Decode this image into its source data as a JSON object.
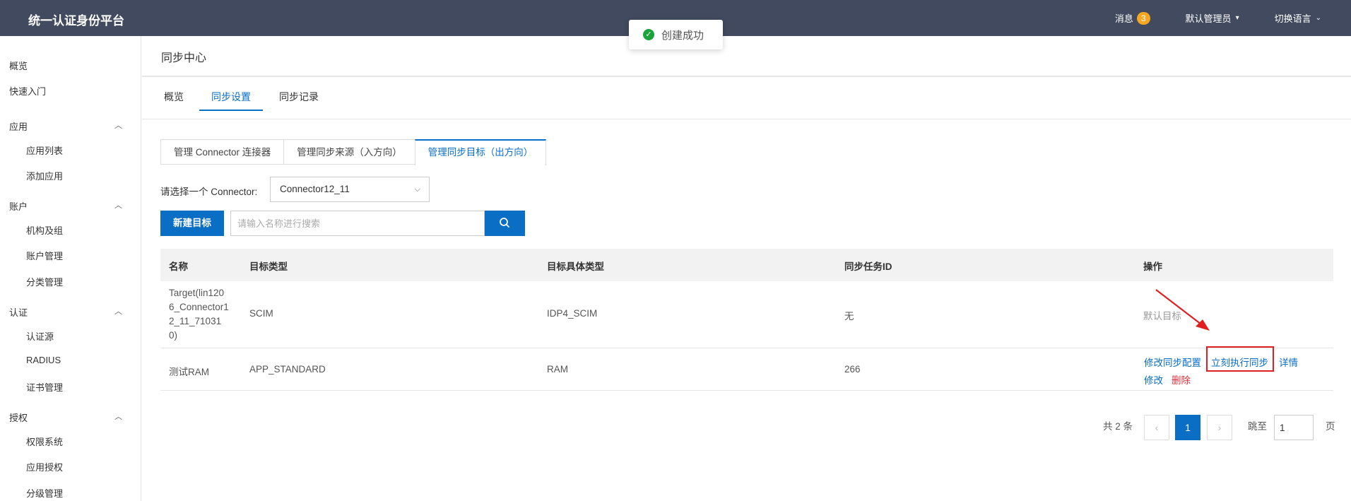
{
  "header": {
    "brand": "统一认证身份平台",
    "messages_label": "消息",
    "messages_count": "3",
    "user_label": "默认管理员",
    "language_label": "切换语言"
  },
  "toast": {
    "text": "创建成功"
  },
  "sidebar": {
    "top_items": [
      "概览",
      "快速入门"
    ],
    "groups": [
      {
        "label": "应用",
        "items": [
          "应用列表",
          "添加应用"
        ]
      },
      {
        "label": "账户",
        "items": [
          "机构及组",
          "账户管理",
          "分类管理"
        ]
      },
      {
        "label": "认证",
        "items": [
          "认证源",
          "RADIUS",
          "证书管理"
        ]
      },
      {
        "label": "授权",
        "items": [
          "权限系统",
          "应用授权",
          "分级管理"
        ]
      }
    ]
  },
  "main": {
    "title": "同步中心",
    "tabs": [
      "概览",
      "同步设置",
      "同步记录"
    ],
    "segments": [
      "管理 Connector 连接器",
      "管理同步来源（入方向）",
      "管理同步目标（出方向）"
    ],
    "connector_label": "请选择一个 Connector:",
    "connector_value": "Connector12_11",
    "new_button": "新建目标",
    "search_placeholder": "请输入名称进行搜索"
  },
  "table": {
    "headers": [
      "名称",
      "目标类型",
      "目标具体类型",
      "同步任务ID",
      "操作"
    ],
    "rows": [
      {
        "name": "Target(lin1206_Connector12_11_710310)",
        "name_lines": [
          "Target(lin120",
          "6_Connector1",
          "2_11_71031",
          "0)"
        ],
        "type": "SCIM",
        "subtype": "IDP4_SCIM",
        "task_id": "无",
        "action": "默认目标"
      },
      {
        "name": "测试RAM",
        "type": "APP_STANDARD",
        "subtype": "RAM",
        "task_id": "266",
        "actions": [
          "修改同步配置",
          "立刻执行同步",
          "详情",
          "修改",
          "删除"
        ]
      }
    ]
  },
  "pagination": {
    "total": "共 2 条",
    "current": "1",
    "goto_label": "跳至",
    "goto_value": "1",
    "page_suffix": "页"
  }
}
